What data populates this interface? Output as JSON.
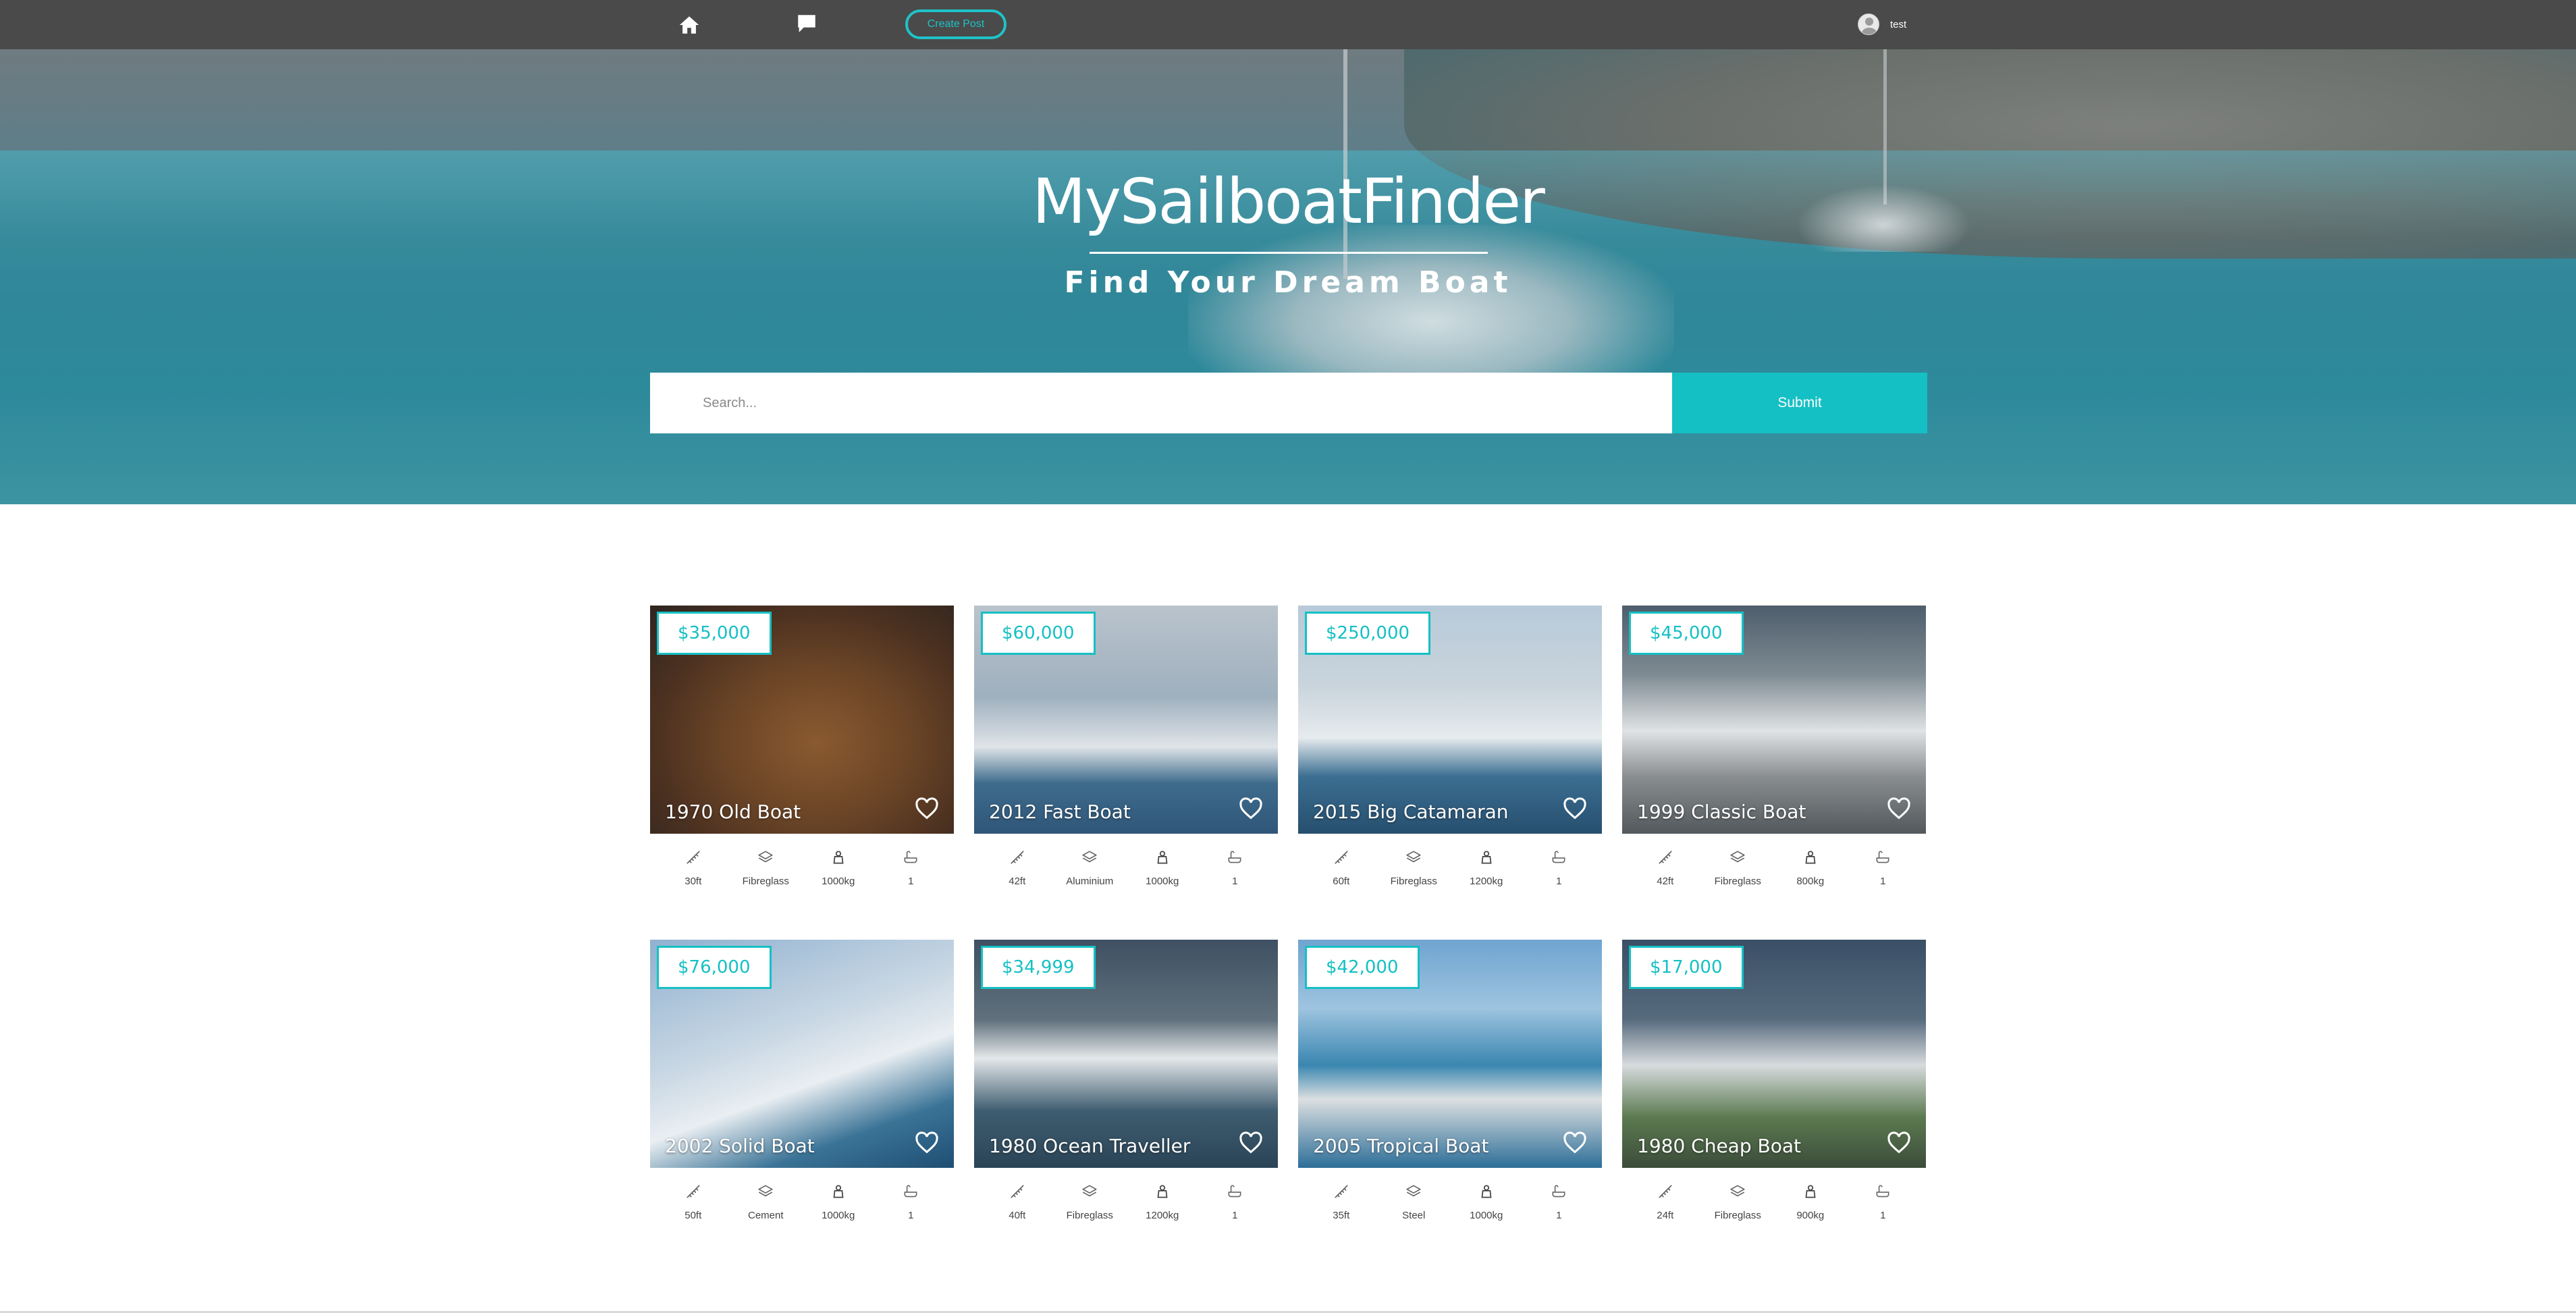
{
  "nav": {
    "create_post": "Create Post",
    "username": "test"
  },
  "hero": {
    "title": "MySailboatFinder",
    "subtitle": "Find Your Dream Boat",
    "search_placeholder": "Search...",
    "submit": "Submit"
  },
  "colors": {
    "accent": "#15c0c4",
    "navbar": "#4a4a4a"
  },
  "listings": [
    {
      "price": "$35,000",
      "name": "1970 Old Boat",
      "length": "30ft",
      "material": "Fibreglass",
      "weight": "1000kg",
      "cabins": "1"
    },
    {
      "price": "$60,000",
      "name": "2012 Fast Boat",
      "length": "42ft",
      "material": "Aluminium",
      "weight": "1000kg",
      "cabins": "1"
    },
    {
      "price": "$250,000",
      "name": "2015 Big Catamaran",
      "length": "60ft",
      "material": "Fibreglass",
      "weight": "1200kg",
      "cabins": "1"
    },
    {
      "price": "$45,000",
      "name": "1999 Classic Boat",
      "length": "42ft",
      "material": "Fibreglass",
      "weight": "800kg",
      "cabins": "1"
    },
    {
      "price": "$76,000",
      "name": "2002 Solid Boat",
      "length": "50ft",
      "material": "Cement",
      "weight": "1000kg",
      "cabins": "1"
    },
    {
      "price": "$34,999",
      "name": "1980 Ocean Traveller",
      "length": "40ft",
      "material": "Fibreglass",
      "weight": "1200kg",
      "cabins": "1"
    },
    {
      "price": "$42,000",
      "name": "2005 Tropical Boat",
      "length": "35ft",
      "material": "Steel",
      "weight": "1000kg",
      "cabins": "1"
    },
    {
      "price": "$17,000",
      "name": "1980 Cheap Boat",
      "length": "24ft",
      "material": "Fibreglass",
      "weight": "900kg",
      "cabins": "1"
    }
  ]
}
